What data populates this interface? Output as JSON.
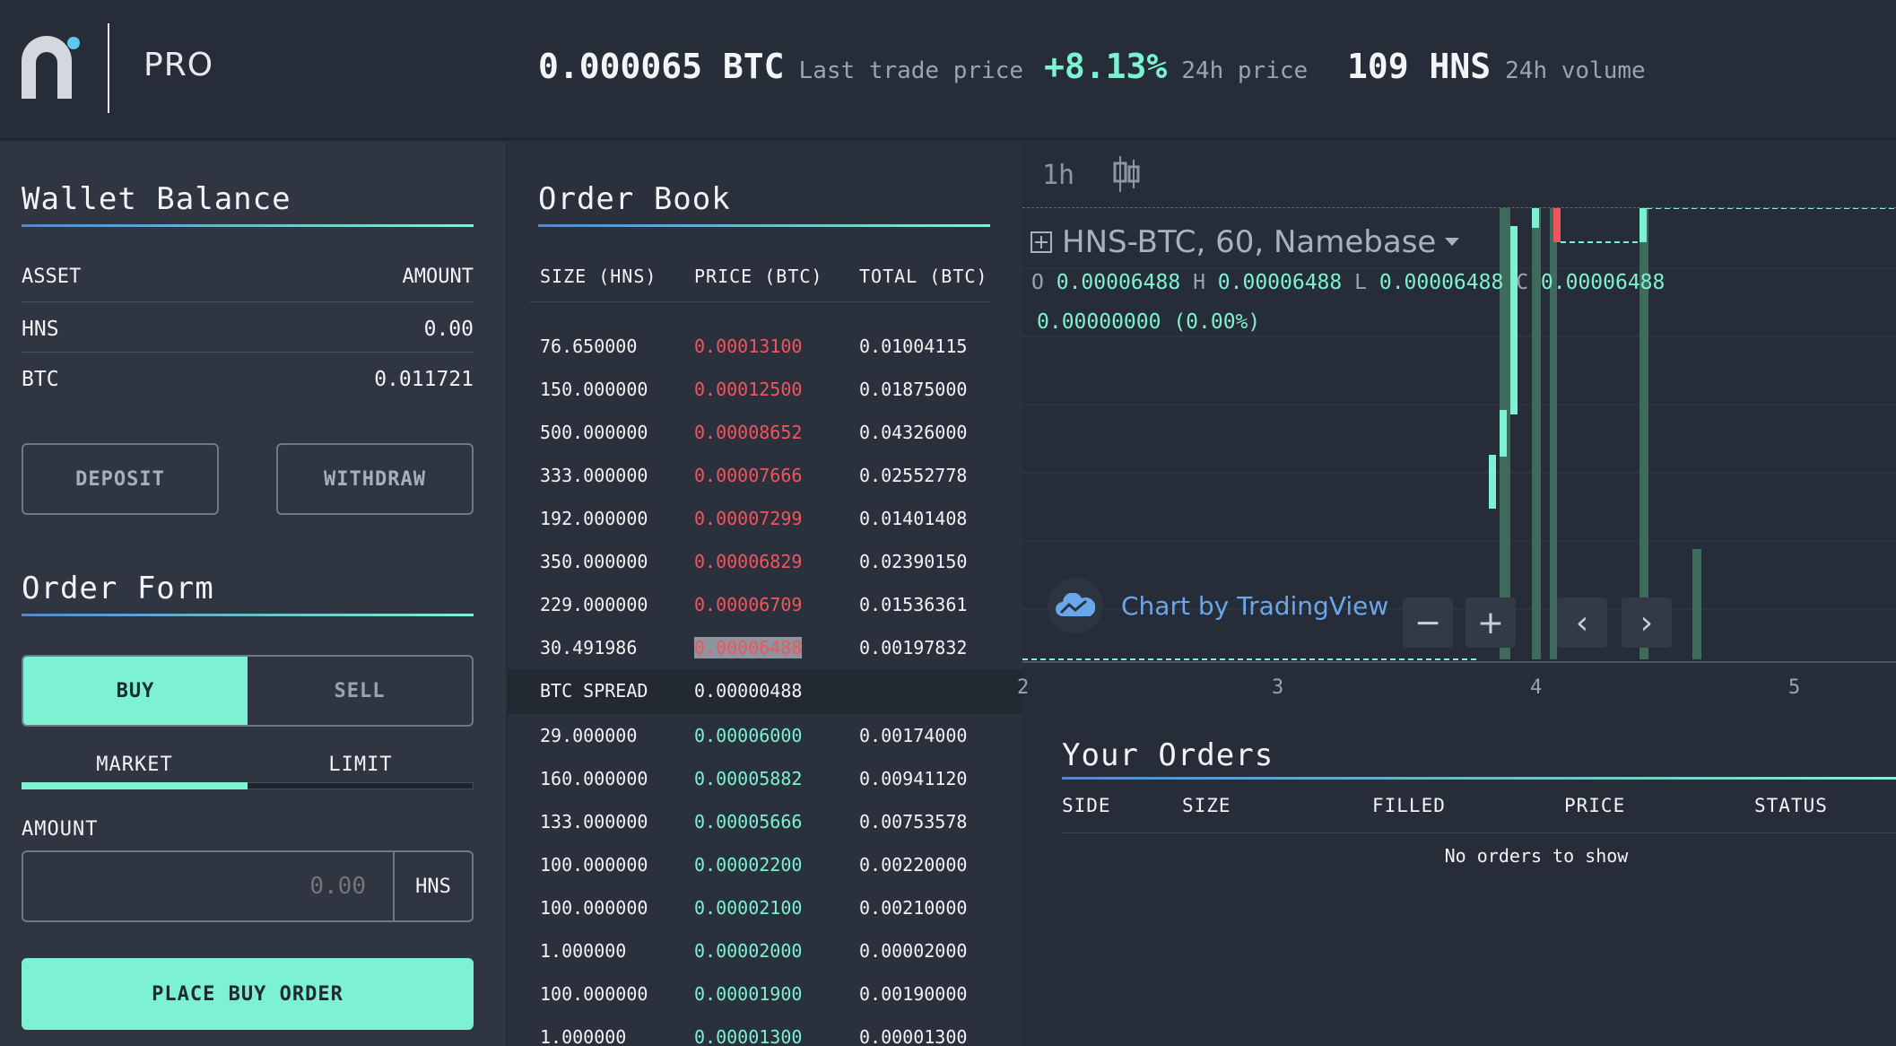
{
  "header": {
    "pro_label": "PRO",
    "last_price_value": "0.000065 BTC",
    "last_price_label": "Last trade price",
    "change_value": "+8.13%",
    "change_label": "24h price",
    "volume_value": "109 HNS",
    "volume_label": "24h volume"
  },
  "wallet": {
    "title": "Wallet Balance",
    "col_asset": "ASSET",
    "col_amount": "AMOUNT",
    "rows": [
      {
        "asset": "HNS",
        "amount": "0.00"
      },
      {
        "asset": "BTC",
        "amount": "0.011721"
      }
    ],
    "deposit_label": "DEPOSIT",
    "withdraw_label": "WITHDRAW"
  },
  "order_form": {
    "title": "Order Form",
    "buy_label": "BUY",
    "sell_label": "SELL",
    "tab_market": "MARKET",
    "tab_limit": "LIMIT",
    "amount_label": "AMOUNT",
    "amount_placeholder": "0.00",
    "amount_unit": "HNS",
    "place_label": "PLACE BUY ORDER"
  },
  "order_book": {
    "title": "Order Book",
    "col_size": "SIZE (HNS)",
    "col_price": "PRICE (BTC)",
    "col_total": "TOTAL (BTC)",
    "asks": [
      {
        "size": "76.650000",
        "price": "0.00013100",
        "total": "0.01004115"
      },
      {
        "size": "150.000000",
        "price": "0.00012500",
        "total": "0.01875000"
      },
      {
        "size": "500.000000",
        "price": "0.00008652",
        "total": "0.04326000"
      },
      {
        "size": "333.000000",
        "price": "0.00007666",
        "total": "0.02552778"
      },
      {
        "size": "192.000000",
        "price": "0.00007299",
        "total": "0.01401408"
      },
      {
        "size": "350.000000",
        "price": "0.00006829",
        "total": "0.02390150"
      },
      {
        "size": "229.000000",
        "price": "0.00006709",
        "total": "0.01536361"
      },
      {
        "size": "30.491986",
        "price": "0.00006488",
        "total": "0.00197832"
      }
    ],
    "spread_label": "BTC SPREAD",
    "spread_value": "0.00000488",
    "bids": [
      {
        "size": "29.000000",
        "price": "0.00006000",
        "total": "0.00174000"
      },
      {
        "size": "160.000000",
        "price": "0.00005882",
        "total": "0.00941120"
      },
      {
        "size": "133.000000",
        "price": "0.00005666",
        "total": "0.00753578"
      },
      {
        "size": "100.000000",
        "price": "0.00002200",
        "total": "0.00220000"
      },
      {
        "size": "100.000000",
        "price": "0.00002100",
        "total": "0.00210000"
      },
      {
        "size": "1.000000",
        "price": "0.00002000",
        "total": "0.00002000"
      },
      {
        "size": "100.000000",
        "price": "0.00001900",
        "total": "0.00190000"
      },
      {
        "size": "1.000000",
        "price": "0.00001300",
        "total": "0.00001300"
      }
    ]
  },
  "chart": {
    "timeframe": "1h",
    "symbol": "HNS-BTC, 60, Namebase",
    "o_key": "O",
    "o_val": "0.00006488",
    "h_key": "H",
    "h_val": "0.00006488",
    "l_key": "L",
    "l_val": "0.00006488",
    "c_key": "C",
    "c_val": "0.00006488",
    "change": "0.00000000 (0.00%)",
    "attribution": "Chart by TradingView",
    "x_ticks": [
      "2",
      "3",
      "4",
      "5"
    ],
    "colors": {
      "up": "#7cf2d2",
      "down": "#f0555d",
      "volume": "#3f6b5c"
    }
  },
  "your_orders": {
    "title": "Your Orders",
    "cols": [
      "SIDE",
      "SIZE",
      "FILLED",
      "PRICE",
      "STATUS"
    ],
    "empty": "No orders to show"
  }
}
